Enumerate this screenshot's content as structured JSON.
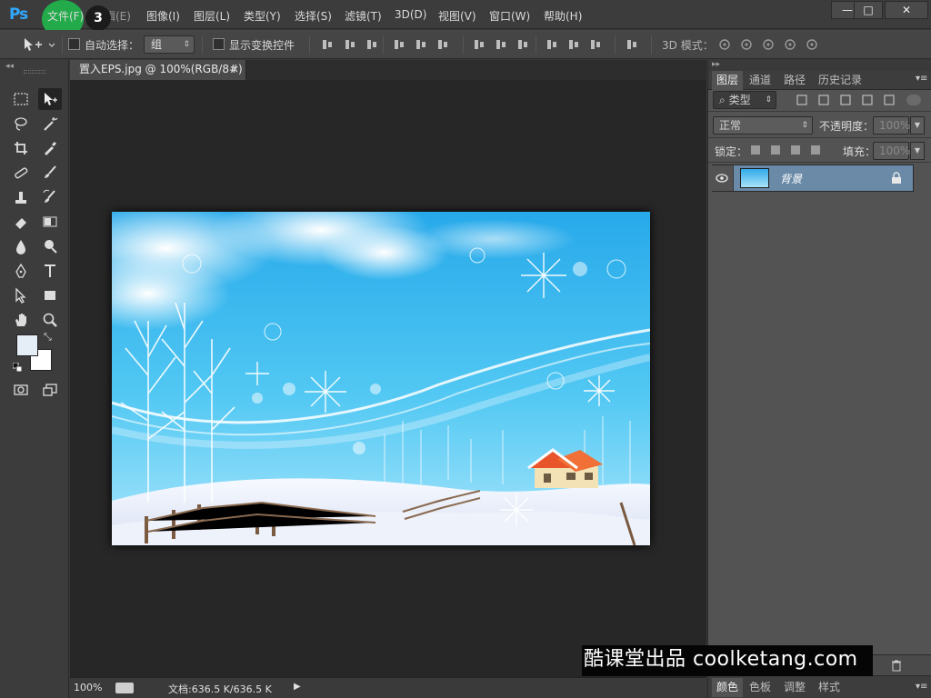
{
  "app": {
    "logo": "Ps"
  },
  "menu": [
    "文件(F)",
    "编辑(E)",
    "图像(I)",
    "图层(L)",
    "类型(Y)",
    "选择(S)",
    "滤镜(T)",
    "3D(D)",
    "视图(V)",
    "窗口(W)",
    "帮助(H)"
  ],
  "step_badge": "3",
  "window_buttons": {
    "minimize": "—",
    "maximize": "□",
    "close": "✕"
  },
  "options": {
    "auto_select_label": "自动选择：",
    "auto_select_value": "组",
    "show_transform_label": "显示变换控件",
    "mode_3d_label": "3D 模式："
  },
  "document": {
    "tab_title": "置入EPS.jpg @ 100%(RGB/8#)",
    "tab_close": "×",
    "zoom": "100%",
    "doc_size": "文档:636.5 K/636.5 K"
  },
  "layers_panel": {
    "tabs": [
      "图层",
      "通道",
      "路径",
      "历史记录"
    ],
    "filter_value": "类型",
    "blend_mode": "正常",
    "opacity_label": "不透明度：",
    "opacity_value": "100%",
    "lock_label": "锁定：",
    "fill_label": "填充：",
    "fill_value": "100%",
    "layer_name": "背景"
  },
  "bottom_panel": {
    "tabs": [
      "颜色",
      "色板",
      "调整",
      "样式"
    ]
  },
  "watermark": "酷课堂出品 coolketang.com",
  "colors": {
    "accent": "#31a8ff",
    "highlight": "#22b14c",
    "layer_selected": "#6a8aa7",
    "foreground": "#e5eef7",
    "background": "#ffffff"
  }
}
